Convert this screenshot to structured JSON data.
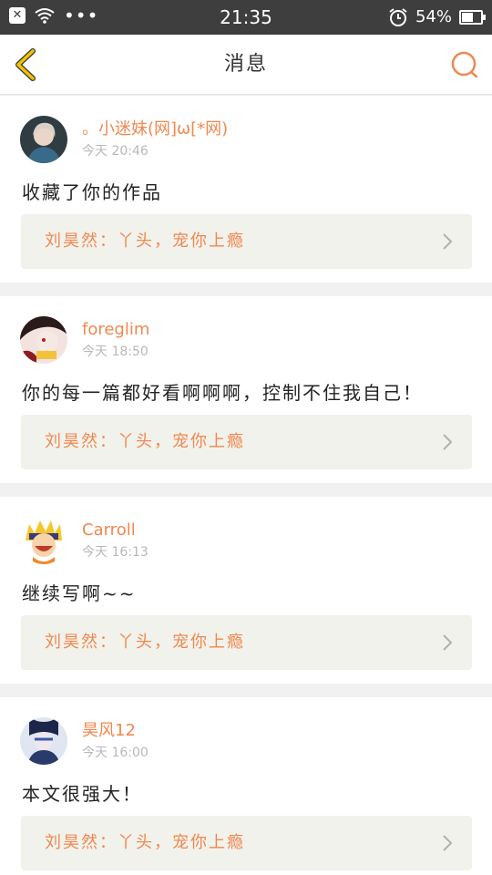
{
  "status_bar": {
    "time": "21:35",
    "battery_text": "54%",
    "battery_level": 0.54,
    "icons": [
      "close-icon",
      "wifi-icon",
      "more-dots-icon",
      "alarm-icon",
      "battery-icon"
    ]
  },
  "nav": {
    "title": "消息",
    "back_icon": "chevron-left-icon",
    "search_icon": "search-icon"
  },
  "colors": {
    "accent": "#f0884f",
    "back_arrow": "#f2c200",
    "status_bar_bg": "#3e3e3e",
    "card_bg": "#ffffff",
    "ref_bg": "#f2f2ec",
    "page_bg": "#f1f1f1"
  },
  "messages": [
    {
      "username": "。小迷妹(网]ω[*网)",
      "time": "今天 20:46",
      "text": "收藏了你的作品",
      "reference": "刘昊然：丫头，宠你上瘾",
      "avatar": "avatar-1"
    },
    {
      "username": "foreglim",
      "time": "今天 18:50",
      "text": "你的每一篇都好看啊啊啊，控制不住我自己！",
      "reference": "刘昊然：丫头，宠你上瘾",
      "avatar": "avatar-2"
    },
    {
      "username": "Carroll",
      "time": "今天 16:13",
      "text": "继续写啊~~",
      "reference": "刘昊然：丫头，宠你上瘾",
      "avatar": "avatar-3"
    },
    {
      "username": "昊风12",
      "time": "今天 16:00",
      "text": "本文很强大！",
      "reference": "刘昊然：丫头，宠你上瘾",
      "avatar": "avatar-4"
    }
  ]
}
